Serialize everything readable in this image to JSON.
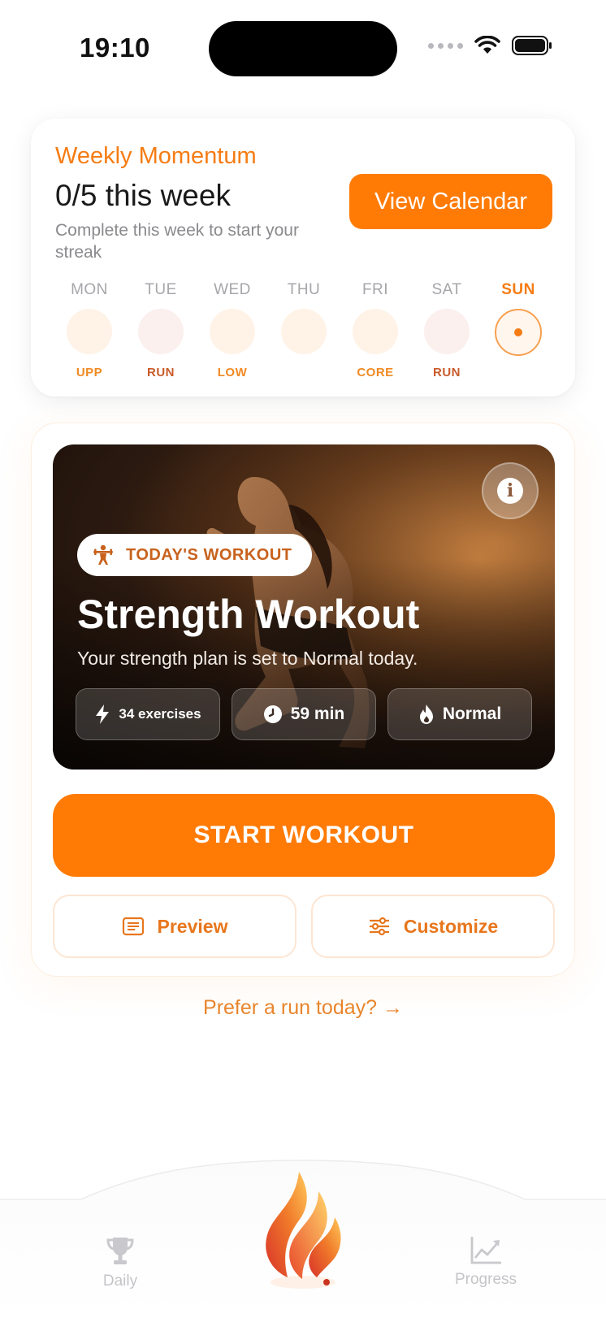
{
  "status_bar": {
    "time": "19:10"
  },
  "weekly": {
    "title": "Weekly Momentum",
    "count": "0/5 this week",
    "subtitle": "Complete this week to start your streak",
    "view_calendar_label": "View Calendar",
    "days": [
      {
        "name": "MON",
        "tag": "UPP"
      },
      {
        "name": "TUE",
        "tag": "RUN"
      },
      {
        "name": "WED",
        "tag": "LOW"
      },
      {
        "name": "THU",
        "tag": ""
      },
      {
        "name": "FRI",
        "tag": "CORE"
      },
      {
        "name": "SAT",
        "tag": "RUN"
      },
      {
        "name": "SUN",
        "tag": ""
      }
    ]
  },
  "workout": {
    "badge": "TODAY'S WORKOUT",
    "title": "Strength Workout",
    "subtitle": "Your strength plan is set to Normal today.",
    "stats": {
      "exercises": "34 exercises",
      "duration": "59 min",
      "intensity": "Normal"
    },
    "start_label": "START WORKOUT",
    "preview_label": "Preview",
    "customize_label": "Customize"
  },
  "run_link": "Prefer a run today? →",
  "tab_bar": {
    "daily_label": "Daily",
    "progress_label": "Progress"
  },
  "colors": {
    "accent": "#ff7b06",
    "accent_text": "#f57c14",
    "muted": "#8a8a8e"
  }
}
